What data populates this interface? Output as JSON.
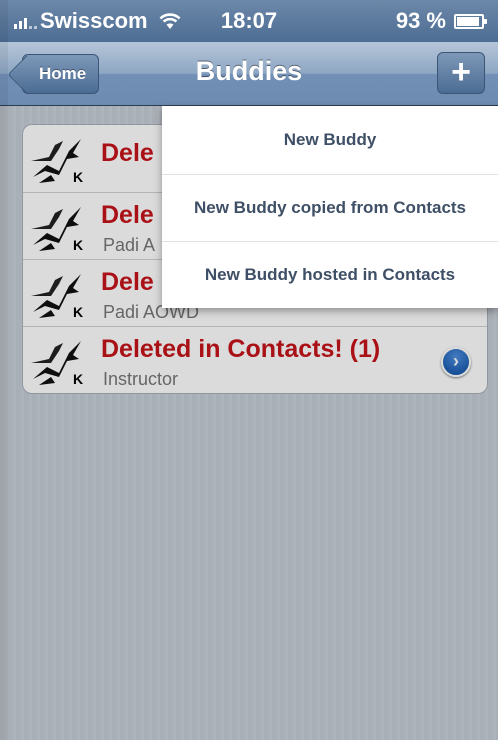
{
  "status_bar": {
    "carrier": "Swisscom",
    "time": "18:07",
    "battery": "93 %",
    "battery_level": 0.93
  },
  "nav": {
    "back_label": "Home",
    "title": "Buddies",
    "add_label": "+"
  },
  "list": {
    "badge": "K",
    "rows": [
      {
        "title": "Dele",
        "subtitle": ""
      },
      {
        "title": "Dele",
        "subtitle": "Padi A"
      },
      {
        "title": "Dele",
        "subtitle": "Padi AOWD"
      },
      {
        "title": "Deleted in Contacts! (1)",
        "subtitle": "Instructor"
      }
    ]
  },
  "menu": {
    "items": [
      "New Buddy",
      "New Buddy copied from Contacts",
      "New Buddy hosted in Contacts"
    ]
  },
  "colors": {
    "nav": "#7290b6",
    "title_red": "#c6141a",
    "menu_text": "#3e4f66",
    "disclosure": "#1d5fb4"
  }
}
